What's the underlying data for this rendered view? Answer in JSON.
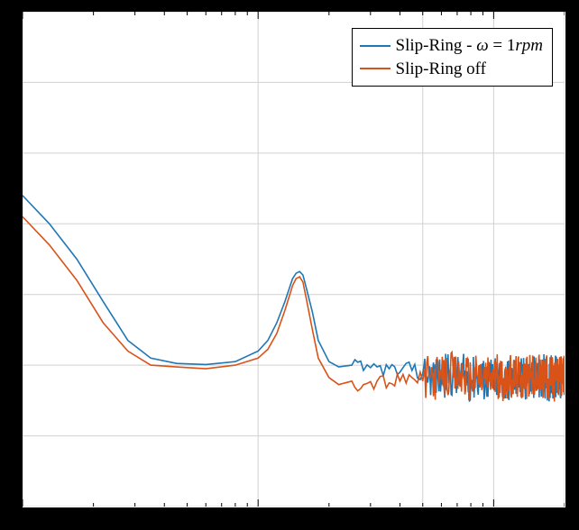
{
  "chart_data": {
    "type": "line",
    "title": "",
    "x_is_log": true,
    "xlim": [
      0.01,
      2.0
    ],
    "ylim": [
      -12,
      2
    ],
    "grid": {
      "x": [
        0.01,
        0.1,
        0.5,
        1.0,
        2.0
      ],
      "y": [
        -12,
        -10,
        -8,
        -6,
        -4,
        -2,
        0,
        2
      ]
    },
    "legend_position": "top-right",
    "series": [
      {
        "name": "Slip-Ring - ω = 1rpm",
        "color": "#1f77b4",
        "x": [
          0.01,
          0.013,
          0.017,
          0.022,
          0.028,
          0.035,
          0.045,
          0.06,
          0.08,
          0.1,
          0.11,
          0.12,
          0.13,
          0.14,
          0.145,
          0.15,
          0.155,
          0.16,
          0.17,
          0.18,
          0.2,
          0.22,
          0.25,
          0.28,
          0.32,
          0.36,
          0.4,
          0.45,
          0.5,
          0.55,
          0.6,
          0.65,
          0.7,
          0.75,
          0.8,
          0.85,
          0.9,
          0.95,
          1.0,
          1.05,
          1.1,
          1.15,
          1.2,
          1.25,
          1.3,
          1.35,
          1.4,
          1.45,
          1.5,
          1.55,
          1.6,
          1.65,
          1.7,
          1.75,
          1.8,
          1.85,
          1.9,
          1.95,
          2.0
        ],
        "y": [
          -3.2,
          -4.0,
          -5.0,
          -6.2,
          -7.3,
          -7.8,
          -7.95,
          -7.98,
          -7.9,
          -7.6,
          -7.3,
          -6.8,
          -6.2,
          -5.55,
          -5.4,
          -5.35,
          -5.45,
          -5.8,
          -6.5,
          -7.3,
          -7.9,
          -8.05,
          -8.0,
          -8.15,
          -8.05,
          -8.1,
          -8.2,
          -8.15,
          -8.25,
          -8.25,
          -8.35,
          -8.25,
          -8.35,
          -8.3,
          -8.4,
          -8.3,
          -8.4,
          -8.35,
          -8.4,
          -8.3,
          -8.4,
          -8.35,
          -8.4,
          -8.3,
          -8.4,
          -8.35,
          -8.4,
          -8.3,
          -8.4,
          -8.35,
          -8.4,
          -8.3,
          -8.4,
          -8.35,
          -8.4,
          -8.3,
          -8.4,
          -8.35,
          -8.4
        ]
      },
      {
        "name": "Slip-Ring off",
        "color": "#d95319",
        "x": [
          0.01,
          0.013,
          0.017,
          0.022,
          0.028,
          0.035,
          0.045,
          0.06,
          0.08,
          0.1,
          0.11,
          0.12,
          0.13,
          0.14,
          0.145,
          0.15,
          0.155,
          0.16,
          0.17,
          0.18,
          0.2,
          0.22,
          0.25,
          0.28,
          0.32,
          0.36,
          0.4,
          0.45,
          0.5,
          0.55,
          0.6,
          0.65,
          0.7,
          0.75,
          0.8,
          0.85,
          0.9,
          0.95,
          1.0,
          1.05,
          1.1,
          1.15,
          1.2,
          1.25,
          1.3,
          1.35,
          1.4,
          1.45,
          1.5,
          1.55,
          1.6,
          1.65,
          1.7,
          1.75,
          1.8,
          1.85,
          1.9,
          1.95,
          2.0
        ],
        "y": [
          -3.8,
          -4.6,
          -5.6,
          -6.8,
          -7.6,
          -8.0,
          -8.05,
          -8.1,
          -8.0,
          -7.8,
          -7.55,
          -7.1,
          -6.45,
          -5.75,
          -5.55,
          -5.5,
          -5.65,
          -6.1,
          -7.0,
          -7.8,
          -8.35,
          -8.55,
          -8.45,
          -8.55,
          -8.45,
          -8.5,
          -8.45,
          -8.35,
          -8.45,
          -8.3,
          -8.4,
          -8.25,
          -8.35,
          -8.3,
          -8.4,
          -8.3,
          -8.4,
          -8.3,
          -8.4,
          -8.3,
          -8.4,
          -8.3,
          -8.4,
          -8.3,
          -8.4,
          -8.3,
          -8.4,
          -8.3,
          -8.4,
          -8.3,
          -8.4,
          -8.3,
          -8.4,
          -8.3,
          -8.4,
          -8.3,
          -8.4,
          -8.3,
          -8.4
        ]
      }
    ]
  },
  "legend": {
    "items": [
      {
        "label_html": "Slip-Ring - <i>ω</i> = 1<i>rpm</i>",
        "label": "Slip-Ring - ω = 1rpm",
        "color": "#1f77b4"
      },
      {
        "label_html": "Slip-Ring off",
        "label": "Slip-Ring off",
        "color": "#d95319"
      }
    ]
  }
}
